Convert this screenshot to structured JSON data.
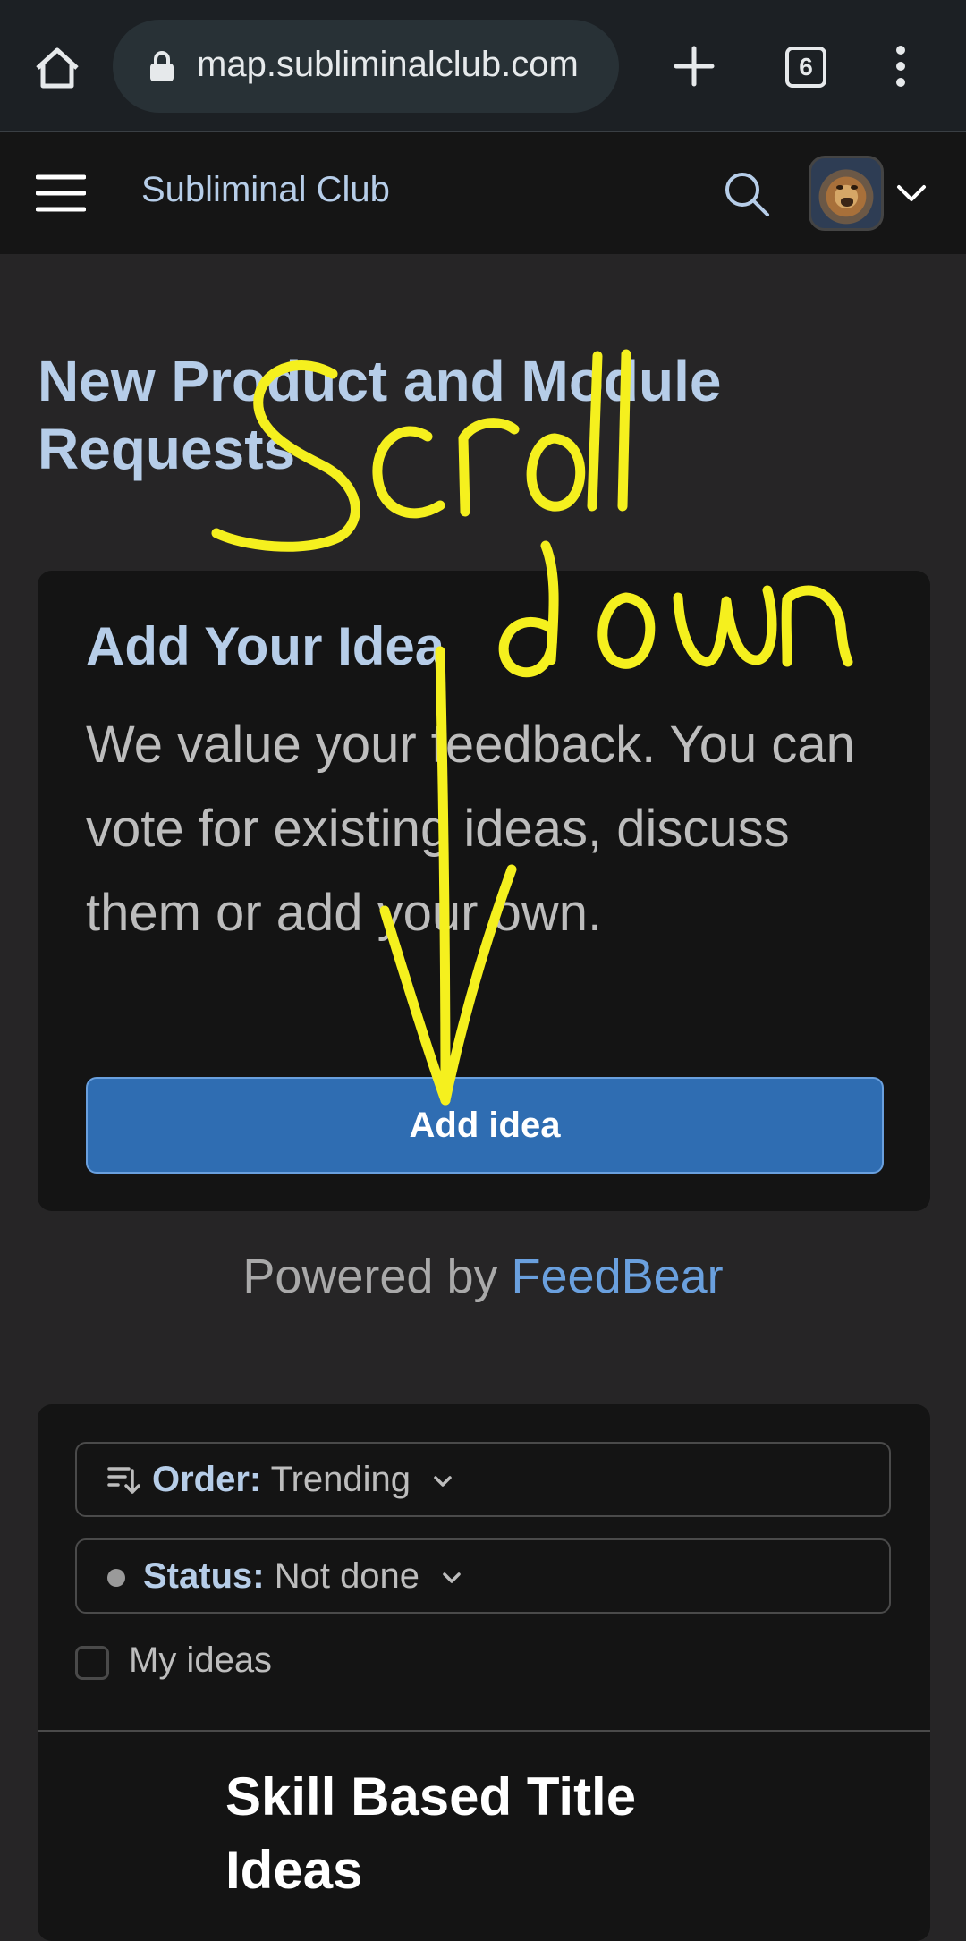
{
  "browser": {
    "url": "map.subliminalclub.com",
    "tab_count": "6"
  },
  "site": {
    "name": "Subliminal Club"
  },
  "page": {
    "title": "New Product and Module Requests"
  },
  "idea_card": {
    "title": "Add Your Idea",
    "description": "We value your feedback. You can vote for existing ideas, discuss them or add your own.",
    "button_label": "Add idea"
  },
  "footer": {
    "powered_prefix": "Powered by",
    "powered_brand": "FeedBear"
  },
  "filters": {
    "order_label": "Order:",
    "order_value": "Trending",
    "status_label": "Status:",
    "status_value": "Not done",
    "my_ideas_label": "My ideas",
    "my_ideas_checked": false
  },
  "ideas": [
    {
      "title": "Skill Based Title Ideas"
    }
  ],
  "annotation": {
    "text": "Scroll down",
    "color": "#f5f01e"
  },
  "colors": {
    "accent": "#2f6db2",
    "link": "#6aa0de",
    "heading": "#b6cde8"
  }
}
